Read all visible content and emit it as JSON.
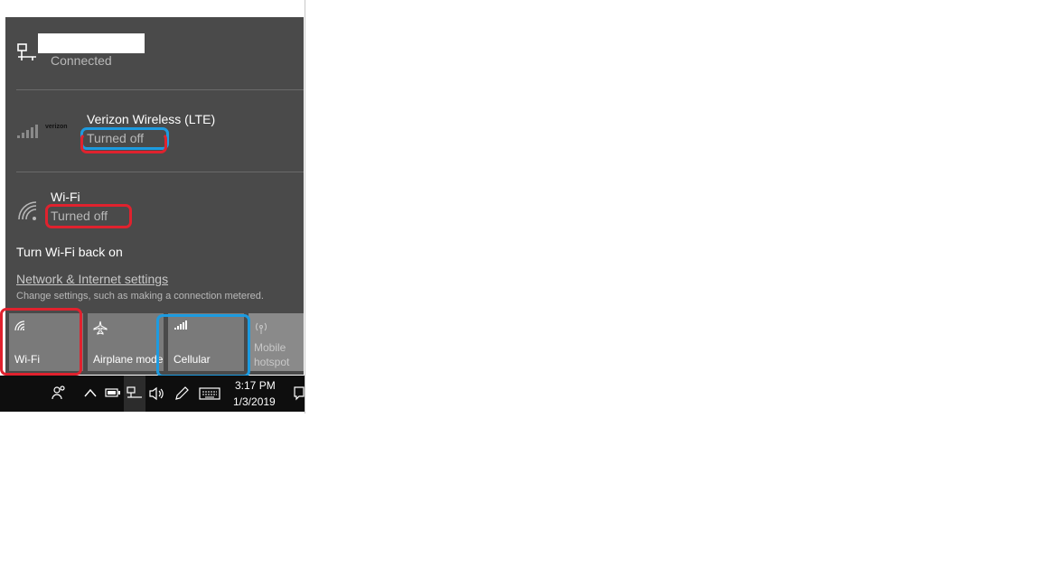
{
  "ethernet": {
    "status": "Connected"
  },
  "cellular_network": {
    "name": "Verizon Wireless (LTE)",
    "status": "Turned off",
    "brand": "verizon"
  },
  "wifi_network": {
    "name": "Wi-Fi",
    "status": "Turned off"
  },
  "wifi_restore": {
    "label": "Turn Wi-Fi back on"
  },
  "settings": {
    "link": "Network & Internet settings",
    "description": "Change settings, such as making a connection metered."
  },
  "quick_actions": [
    {
      "label": "Wi-Fi",
      "icon": "wifi-icon"
    },
    {
      "label": "Airplane mode",
      "icon": "airplane-icon"
    },
    {
      "label": "Cellular",
      "icon": "cellular-icon"
    },
    {
      "label": "Mobile\nhotspot",
      "icon": "hotspot-icon"
    }
  ],
  "taskbar": {
    "time": "3:17 PM",
    "date": "1/3/2019"
  },
  "colors": {
    "highlight_red": "#e0222e",
    "highlight_blue": "#1d9be0",
    "panel": "#4a4a4a"
  }
}
